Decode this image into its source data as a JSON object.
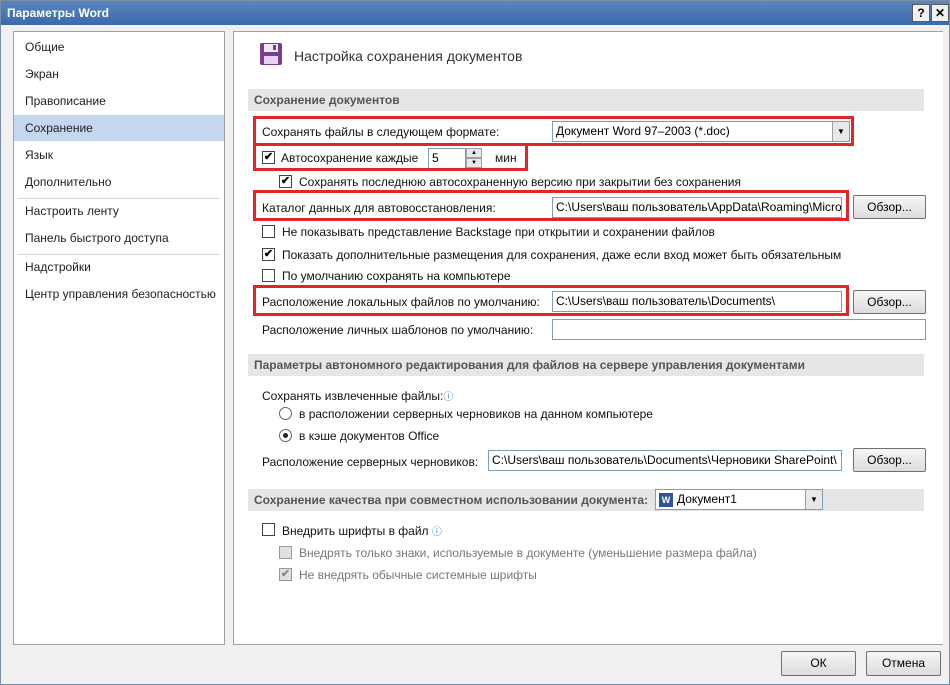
{
  "window": {
    "title": "Параметры Word",
    "help_glyph": "?",
    "close_glyph": "✕"
  },
  "sidebar": {
    "items": [
      {
        "label": "Общие"
      },
      {
        "label": "Экран"
      },
      {
        "label": "Правописание"
      },
      {
        "label": "Сохранение"
      },
      {
        "label": "Язык"
      },
      {
        "label": "Дополнительно"
      },
      {
        "label": "Настроить ленту"
      },
      {
        "label": "Панель быстрого доступа"
      },
      {
        "label": "Надстройки"
      },
      {
        "label": "Центр управления безопасностью"
      }
    ],
    "active_index": 3
  },
  "page": {
    "title": "Настройка сохранения документов"
  },
  "save_section": {
    "header": "Сохранение документов",
    "format_label": "Сохранять файлы в следующем формате:",
    "format_value": "Документ Word 97–2003 (*.doc)",
    "autosave_label": "Автосохранение каждые",
    "autosave_checked": true,
    "autosave_value": "5",
    "autosave_unit": "мин",
    "keep_last_label": "Сохранять последнюю автосохраненную версию при закрытии без сохранения",
    "keep_last_checked": true,
    "autorecover_label": "Каталог данных для автовосстановления:",
    "autorecover_value": "C:\\Users\\ваш пользователь\\AppData\\Roaming\\Micros",
    "browse_label": "Обзор...",
    "no_backstage_label": "Не показывать представление Backstage при открытии и сохранении файлов",
    "no_backstage_checked": false,
    "show_places_label": "Показать дополнительные размещения для сохранения, даже если вход может быть обязательным",
    "show_places_checked": true,
    "save_local_label": "По умолчанию сохранять на компьютере",
    "save_local_checked": false,
    "local_files_label": "Расположение локальных файлов по умолчанию:",
    "local_files_value": "C:\\Users\\ваш пользователь\\Documents\\",
    "templates_label": "Расположение личных шаблонов по умолчанию:",
    "templates_value": ""
  },
  "offline_section": {
    "header": "Параметры автономного редактирования для файлов на сервере управления документами",
    "save_checked_out_label": "Сохранять извлеченные файлы:",
    "radio_server_drafts": "в расположении серверных черновиков на данном компьютере",
    "radio_office_cache": "в кэше документов Office",
    "selected": "office_cache",
    "server_drafts_label": "Расположение серверных черновиков:",
    "server_drafts_value": "C:\\Users\\ваш пользователь\\Documents\\Черновики SharePoint\\",
    "browse_label": "Обзор..."
  },
  "fidelity_section": {
    "header": "Сохранение качества при совместном использовании документа:",
    "document_value": "Документ1",
    "embed_fonts_label": "Внедрить шрифты в файл",
    "embed_fonts_checked": false,
    "embed_used_only_label": "Внедрять только знаки, используемые в документе (уменьшение размера файла)",
    "embed_used_only_checked": false,
    "no_system_fonts_label": "Не внедрять обычные системные шрифты",
    "no_system_fonts_checked": true
  },
  "footer": {
    "ok_label": "ОК",
    "cancel_label": "Отмена"
  },
  "icons": {
    "info": "ⓘ",
    "check": "✔",
    "dropdown": "▼",
    "spin_up": "▲",
    "spin_down": "▼",
    "word": "W"
  },
  "colors": {
    "highlight": "#e0262b",
    "selection": "#c5d7ee",
    "title_bar": "#3a6aa8",
    "save_icon": "#7a3e8f"
  }
}
